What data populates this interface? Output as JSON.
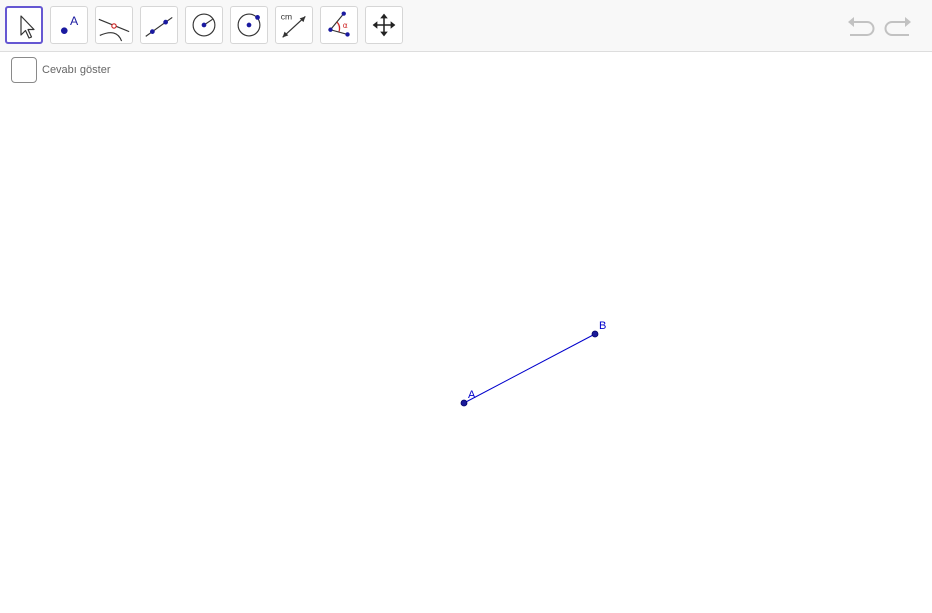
{
  "toolbar": {
    "tools": [
      {
        "name": "move",
        "icon": "cursor-arrow-icon",
        "selected": true
      },
      {
        "name": "point",
        "icon": "point-icon",
        "glyph": "A"
      },
      {
        "name": "intersect",
        "icon": "intersect-icon"
      },
      {
        "name": "line",
        "icon": "line-through-points-icon"
      },
      {
        "name": "circle-center-point",
        "icon": "circle-center-point-icon"
      },
      {
        "name": "circle-center-radius",
        "icon": "circle-through-point-icon"
      },
      {
        "name": "distance",
        "icon": "distance-length-icon",
        "glyph": "cm"
      },
      {
        "name": "angle",
        "icon": "angle-icon",
        "glyph": "α"
      },
      {
        "name": "move-graphics-view",
        "icon": "move-graphics-view-icon"
      }
    ],
    "undo_icon": "undo-icon",
    "redo_icon": "redo-icon"
  },
  "checkbox": {
    "label": "Cevabı göster",
    "checked": false
  },
  "construction": {
    "points": [
      {
        "label": "A"
      },
      {
        "label": "B"
      }
    ],
    "segment": "AB",
    "color": "#0000cc"
  }
}
